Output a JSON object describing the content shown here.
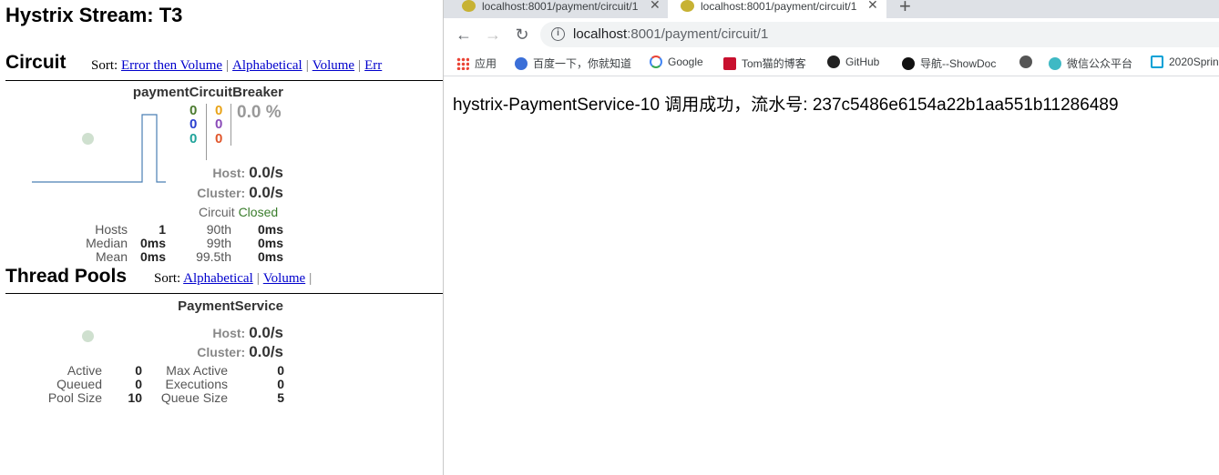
{
  "dashboard": {
    "title": "Hystrix Stream: T3",
    "circuit_section": {
      "title": "Circuit",
      "sort_label": "Sort:",
      "sort_options": [
        "Error then Volume",
        "Alphabetical",
        "Volume",
        "Err"
      ]
    },
    "circuit": {
      "name": "paymentCircuitBreaker",
      "counts_left": [
        "0",
        "0",
        "0"
      ],
      "counts_right": [
        "0",
        "0",
        "0"
      ],
      "error_pct": "0.0 %",
      "host_label": "Host:",
      "host_rate": "0.0/s",
      "cluster_label": "Cluster:",
      "cluster_rate": "0.0/s",
      "circuit_label": "Circuit",
      "circuit_status": "Closed",
      "stats": {
        "hosts_label": "Hosts",
        "hosts": "1",
        "median_label": "Median",
        "median": "0ms",
        "mean_label": "Mean",
        "mean": "0ms",
        "p90_label": "90th",
        "p90": "0ms",
        "p99_label": "99th",
        "p99": "0ms",
        "p995_label": "99.5th",
        "p995": "0ms"
      }
    },
    "threadpool_section": {
      "title": "Thread Pools",
      "sort_label": "Sort:",
      "sort_options": [
        "Alphabetical",
        "Volume"
      ]
    },
    "threadpool": {
      "name": "PaymentService",
      "host_label": "Host:",
      "host_rate": "0.0/s",
      "cluster_label": "Cluster:",
      "cluster_rate": "0.0/s",
      "stats": {
        "active_label": "Active",
        "active": "0",
        "queued_label": "Queued",
        "queued": "0",
        "pool_size_label": "Pool Size",
        "pool_size": "10",
        "max_active_label": "Max Active",
        "max_active": "0",
        "executions_label": "Executions",
        "executions": "0",
        "queue_size_label": "Queue Size",
        "queue_size": "5"
      }
    },
    "colors": {
      "count_green": "#4a7a2e",
      "count_blue": "#2a3fcf",
      "count_teal": "#1fa39a",
      "count_orange": "#e8a317",
      "count_purple": "#8a4bb8",
      "count_red": "#e0562b",
      "status_closed": "#3a7d2c",
      "link": "#0000cc"
    }
  },
  "browser": {
    "tabs": [
      {
        "title": "localhost:8001/payment/circuit/1",
        "close": "✕"
      },
      {
        "title": "localhost:8001/payment/circuit/1",
        "close": "✕"
      }
    ],
    "new_tab": "+",
    "back": "←",
    "forward": "→",
    "reload": "↻",
    "url_host": "localhost",
    "url_path": ":8001/payment/circuit/1",
    "bookmarks": [
      "应用",
      "百度一下，你就知道",
      "Google",
      "Tom猫的博客",
      "GitHub",
      "导航--ShowDoc",
      "",
      "微信公众平台",
      "2020Sprin"
    ],
    "page_text": "hystrix-PaymentService-10 调用成功，流水号: 237c5486e6154a22b1aa551b11286489"
  }
}
